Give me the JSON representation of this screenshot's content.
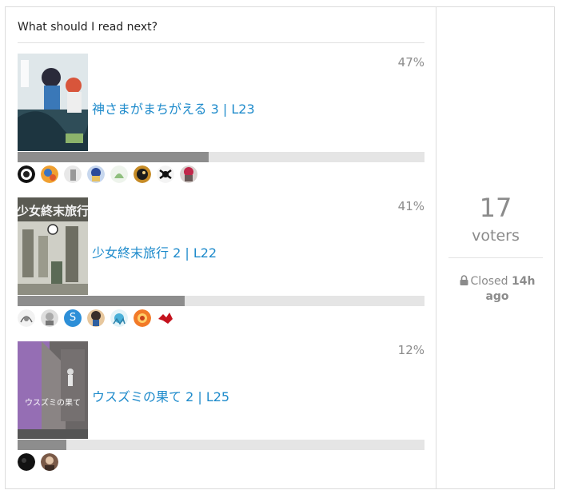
{
  "poll": {
    "question": "What should I read next?",
    "options": [
      {
        "label": "神さまがまちがえる 3 | L23",
        "percent_text": "47%",
        "fraction": 0.47,
        "voter_icons": [
          "avatar-1",
          "avatar-2",
          "avatar-3",
          "avatar-4",
          "avatar-5",
          "avatar-6",
          "avatar-7",
          "avatar-8"
        ]
      },
      {
        "label": "少女終末旅行 2 | L22",
        "percent_text": "41%",
        "fraction": 0.41,
        "voter_icons": [
          "avatar-1",
          "avatar-2",
          "avatar-3",
          "avatar-4",
          "avatar-5",
          "avatar-6",
          "avatar-7"
        ]
      },
      {
        "label": "ウスズミの果て 2 | L25",
        "percent_text": "12%",
        "fraction": 0.12,
        "voter_icons": [
          "avatar-1",
          "avatar-2"
        ]
      }
    ],
    "avatar_letter": "S",
    "cover2_title": "少女終末旅行",
    "cover3_title": "ウスズミの果て"
  },
  "sidebar": {
    "voter_count": "17",
    "voter_label": "voters",
    "closed_prefix": "Closed",
    "closed_time": "14h ago",
    "lock_icon": "lock-icon"
  },
  "colors": {
    "link": "#1d8acb",
    "bar_fill": "#8d8d8d",
    "bar_bg": "#e5e5e5",
    "muted": "#8b8b8b"
  }
}
